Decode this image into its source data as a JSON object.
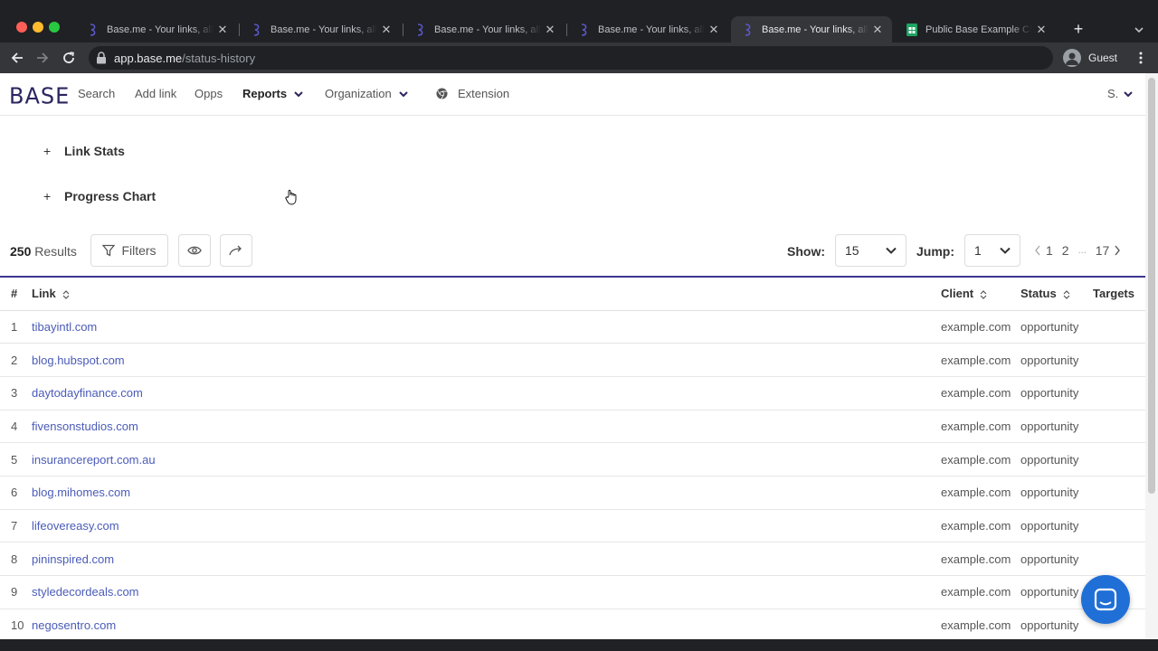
{
  "browser": {
    "tabs": [
      {
        "title": "Base.me - Your links, all",
        "active": false
      },
      {
        "title": "Base.me - Your links, all",
        "active": false
      },
      {
        "title": "Base.me - Your links, all",
        "active": false
      },
      {
        "title": "Base.me - Your links, all",
        "active": false
      },
      {
        "title": "Base.me - Your links, all",
        "active": true
      },
      {
        "title": "Public Base Example CS",
        "active": false
      }
    ],
    "url_host": "app.base.me",
    "url_path": "/status-history",
    "profile_label": "Guest"
  },
  "nav": {
    "logo": "BASE",
    "items": [
      "Search",
      "Add link",
      "Opps"
    ],
    "reports": "Reports",
    "organization": "Organization",
    "extension": "Extension",
    "user": "S."
  },
  "sections": {
    "link_stats": "Link Stats",
    "progress_chart": "Progress Chart"
  },
  "results": {
    "count": "250",
    "count_label": "Results",
    "filters_label": "Filters",
    "show_label": "Show:",
    "show_value": "15",
    "jump_label": "Jump:",
    "jump_value": "1",
    "pages": [
      "1",
      "2",
      "...",
      "17"
    ]
  },
  "table": {
    "headers": {
      "num": "#",
      "link": "Link",
      "client": "Client",
      "status": "Status",
      "targets": "Targets"
    },
    "rows": [
      {
        "num": "1",
        "link": "tibayintl.com",
        "client": "example.com",
        "status": "opportunity"
      },
      {
        "num": "2",
        "link": "blog.hubspot.com",
        "client": "example.com",
        "status": "opportunity"
      },
      {
        "num": "3",
        "link": "daytodayfinance.com",
        "client": "example.com",
        "status": "opportunity"
      },
      {
        "num": "4",
        "link": "fivensonstudios.com",
        "client": "example.com",
        "status": "opportunity"
      },
      {
        "num": "5",
        "link": "insurancereport.com.au",
        "client": "example.com",
        "status": "opportunity"
      },
      {
        "num": "6",
        "link": "blog.mihomes.com",
        "client": "example.com",
        "status": "opportunity"
      },
      {
        "num": "7",
        "link": "lifeovereasy.com",
        "client": "example.com",
        "status": "opportunity"
      },
      {
        "num": "8",
        "link": "pininspired.com",
        "client": "example.com",
        "status": "opportunity"
      },
      {
        "num": "9",
        "link": "styledecordeals.com",
        "client": "example.com",
        "status": "opportunity"
      },
      {
        "num": "10",
        "link": "negosentro.com",
        "client": "example.com",
        "status": "opportunity"
      }
    ]
  },
  "colors": {
    "brand": "#2b2560",
    "accent_border": "#3d3791",
    "link": "#4a5bb8",
    "chat": "#1f6fd6"
  }
}
